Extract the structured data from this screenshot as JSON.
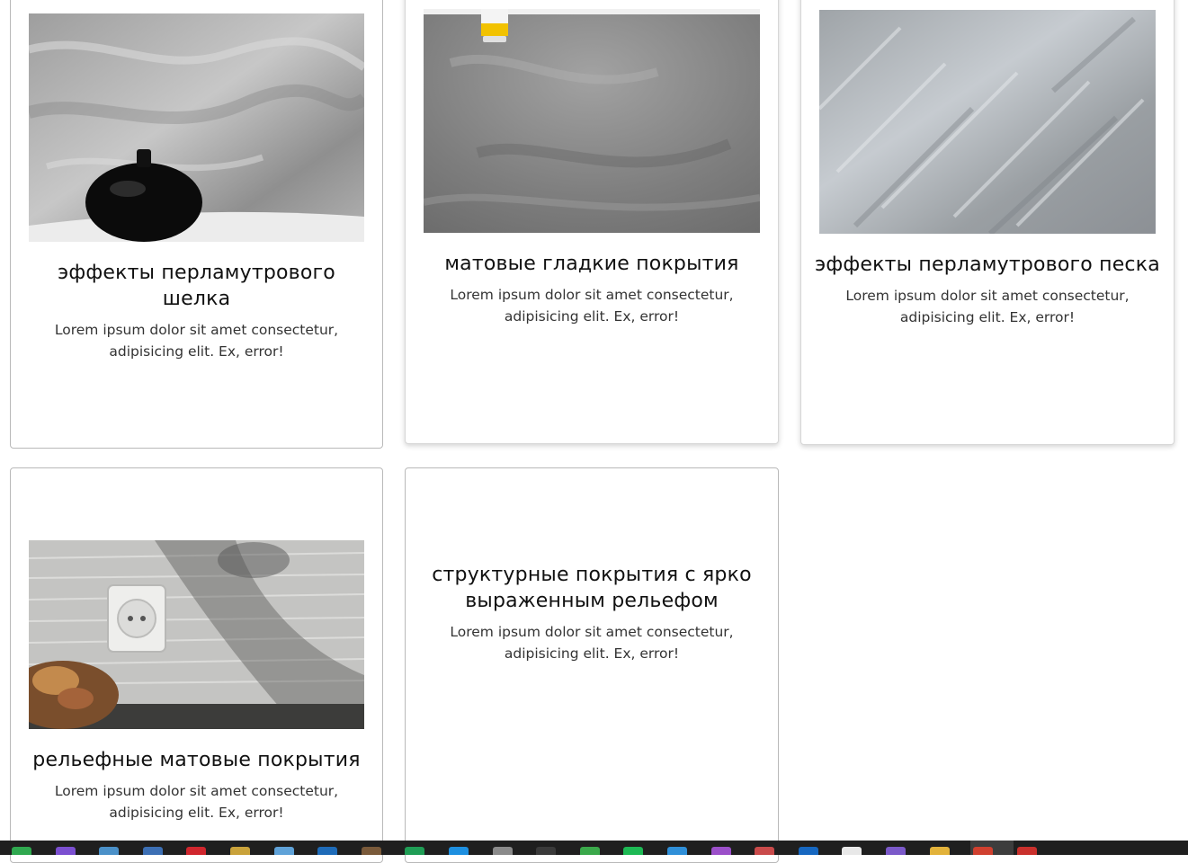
{
  "cards": [
    {
      "title": "эффекты перламутрового шелка",
      "text": "Lorem ipsum dolor sit amet consectetur, adipisicing elit. Ex, error!",
      "image": "pearl-silk-wall-with-black-vase"
    },
    {
      "title": "матовые гладкие покрытия",
      "text": "Lorem ipsum dolor sit amet consectetur, adipisicing elit. Ex, error!",
      "image": "matte-smooth-grey-plaster"
    },
    {
      "title": "эффекты перламутрового песка",
      "text": "Lorem ipsum dolor sit amet consectetur, adipisicing elit. Ex, error!",
      "image": "pearl-sand-silver-texture"
    },
    {
      "title": "рельефные матовые покрытия",
      "text": "Lorem ipsum dolor sit amet consectetur, adipisicing elit. Ex, error!",
      "image": "relief-wall-with-power-socket"
    },
    {
      "title": "структурные покрытия с ярко выраженным рельефом",
      "text": "Lorem ipsum dolor sit amet consectetur, adipisicing elit. Ex, error!"
    }
  ],
  "taskbar": {
    "icons": [
      {
        "name": "chrome-icon",
        "color": "#2fa84f"
      },
      {
        "name": "visual-studio-icon",
        "color": "#7b4fd0"
      },
      {
        "name": "app-icon",
        "color": "#4a90c8"
      },
      {
        "name": "app-icon",
        "color": "#3c6fb4"
      },
      {
        "name": "opera-icon",
        "color": "#d0262d"
      },
      {
        "name": "app-icon",
        "color": "#c9a23a"
      },
      {
        "name": "app-icon",
        "color": "#5fa2d8"
      },
      {
        "name": "app-icon",
        "color": "#1e6bb8"
      },
      {
        "name": "app-icon",
        "color": "#7a5a3a"
      },
      {
        "name": "excel-icon",
        "color": "#1f9d55"
      },
      {
        "name": "vscode-icon",
        "color": "#1d8fe0"
      },
      {
        "name": "app-icon",
        "color": "#8a8a8a"
      },
      {
        "name": "terminal-icon",
        "color": "#3a3a3a"
      },
      {
        "name": "app-icon",
        "color": "#3aa84a"
      },
      {
        "name": "spotify-icon",
        "color": "#1db954"
      },
      {
        "name": "app-icon",
        "color": "#2f8fd8"
      },
      {
        "name": "app-icon",
        "color": "#9b4fc9"
      },
      {
        "name": "app-icon",
        "color": "#c94a4a"
      },
      {
        "name": "app-icon",
        "color": "#1667c0"
      },
      {
        "name": "app-icon",
        "color": "#e8e8e8"
      },
      {
        "name": "viber-icon",
        "color": "#7b59c9"
      },
      {
        "name": "folder-icon",
        "color": "#e2b23a"
      },
      {
        "name": "app-icon",
        "color": "#d0402f"
      },
      {
        "name": "app-icon",
        "color": "#c9302c"
      }
    ]
  }
}
